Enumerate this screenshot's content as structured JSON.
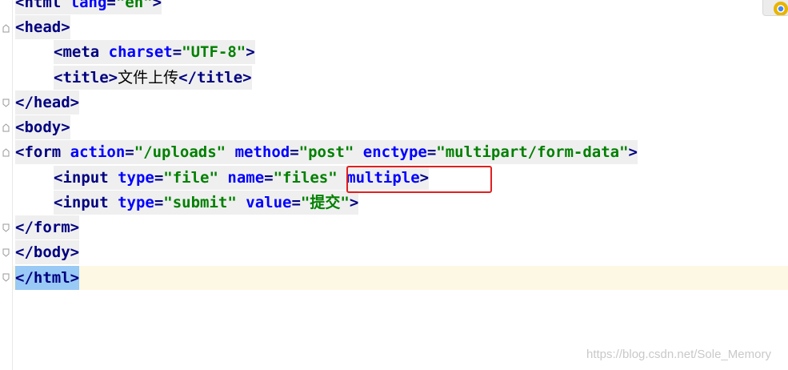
{
  "code_lines": [
    {
      "id": "l1",
      "parts": [
        [
          "tag",
          "<html "
        ],
        [
          "attr",
          "lang"
        ],
        [
          "tag",
          "="
        ],
        [
          "str",
          "\"en\""
        ],
        [
          "tag",
          ">"
        ]
      ]
    },
    {
      "id": "l2",
      "parts": [
        [
          "tag",
          "<head>"
        ]
      ]
    },
    {
      "id": "l3",
      "parts": [
        [
          "tag",
          "<meta "
        ],
        [
          "attr",
          "charset"
        ],
        [
          "tag",
          "="
        ],
        [
          "str",
          "\"UTF-8\""
        ],
        [
          "tag",
          ">"
        ]
      ]
    },
    {
      "id": "l4",
      "parts": [
        [
          "tag",
          "<title>"
        ],
        [
          "txt",
          "文件上传"
        ],
        [
          "tag",
          "</title>"
        ]
      ]
    },
    {
      "id": "l5",
      "parts": [
        [
          "tag",
          "</head>"
        ]
      ]
    },
    {
      "id": "l6",
      "parts": [
        [
          "tag",
          "<body>"
        ]
      ]
    },
    {
      "id": "l7",
      "parts": [
        [
          "tag",
          "<form "
        ],
        [
          "attr",
          "action"
        ],
        [
          "tag",
          "="
        ],
        [
          "str",
          "\"/uploads\""
        ],
        [
          "tag",
          " "
        ],
        [
          "attr",
          "method"
        ],
        [
          "tag",
          "="
        ],
        [
          "str",
          "\"post\""
        ],
        [
          "tag",
          " "
        ],
        [
          "attr",
          "enctype"
        ],
        [
          "tag",
          "="
        ],
        [
          "str",
          "\"multipart/form-data\""
        ],
        [
          "tag",
          ">"
        ]
      ]
    },
    {
      "id": "l8",
      "parts": [
        [
          "tag",
          "<input "
        ],
        [
          "attr",
          "type"
        ],
        [
          "tag",
          "="
        ],
        [
          "str",
          "\"file\""
        ],
        [
          "tag",
          " "
        ],
        [
          "attr",
          "name"
        ],
        [
          "tag",
          "="
        ],
        [
          "str",
          "\"files\""
        ],
        [
          "tag",
          " "
        ],
        [
          "attr",
          "multiple"
        ],
        [
          "tag",
          ">"
        ]
      ]
    },
    {
      "id": "l9",
      "parts": [
        [
          "tag",
          "<input "
        ],
        [
          "attr",
          "type"
        ],
        [
          "tag",
          "="
        ],
        [
          "str",
          "\"submit\""
        ],
        [
          "tag",
          " "
        ],
        [
          "attr",
          "value"
        ],
        [
          "tag",
          "="
        ],
        [
          "str",
          "\"提交\""
        ],
        [
          "tag",
          ">"
        ]
      ]
    },
    {
      "id": "l10",
      "parts": [
        [
          "tag",
          "</form>"
        ]
      ]
    },
    {
      "id": "l11",
      "parts": [
        [
          "tag",
          "</body>"
        ]
      ]
    },
    {
      "id": "l12",
      "parts": [
        [
          "tag",
          "</html>"
        ]
      ]
    }
  ],
  "watermark": "https://blog.csdn.net/Sole_Memory",
  "colors": {
    "tag": "#000080",
    "attribute": "#0000ff",
    "string": "#008000",
    "highlight_box": "#e02020",
    "current_line": "#fdf8e3",
    "selection": "#99c9f5"
  },
  "icons": {
    "browser": "chrome-icon",
    "fold": "fold-marker-icon"
  }
}
